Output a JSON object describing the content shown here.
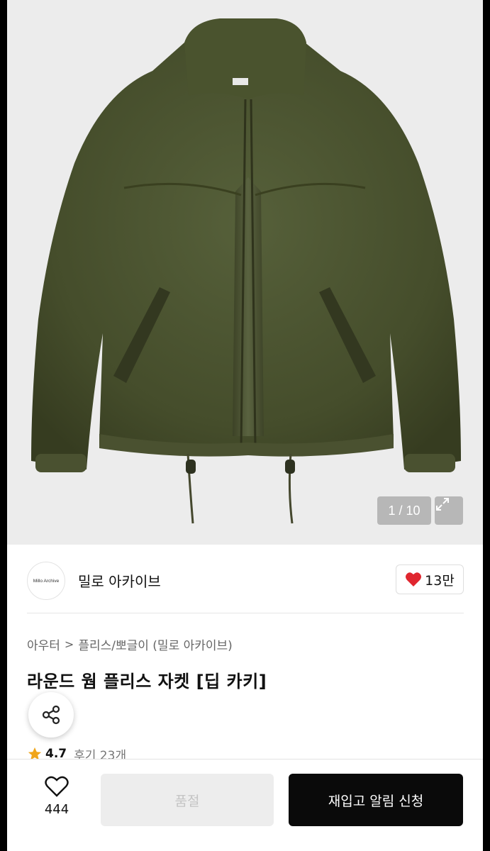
{
  "gallery": {
    "counter": "1 / 10",
    "image_alt": "olive fleece jacket"
  },
  "brand": {
    "logo_text": "Millo Archive",
    "name": "밀로 아카이브",
    "likes": "13만"
  },
  "breadcrumb": {
    "items": [
      "아우터",
      "플리스/뽀글이 (밀로 아카이브)"
    ],
    "separator": ">"
  },
  "product": {
    "title": "라운드 웜 플리스 자켓 [딥 카키]",
    "rating": "4.7",
    "reviews": "후기 23개"
  },
  "bottom_bar": {
    "wish_count": "444",
    "soldout_label": "품절",
    "notify_label": "재입고 알림 신청"
  },
  "colors": {
    "accent": "#0a0a0a",
    "heart": "#e0262f",
    "star": "#f0a51a",
    "jacket": "#4c5530"
  },
  "icons": [
    "expand-icon",
    "heart-icon",
    "share-icon",
    "star-icon",
    "heart-outline-icon"
  ]
}
